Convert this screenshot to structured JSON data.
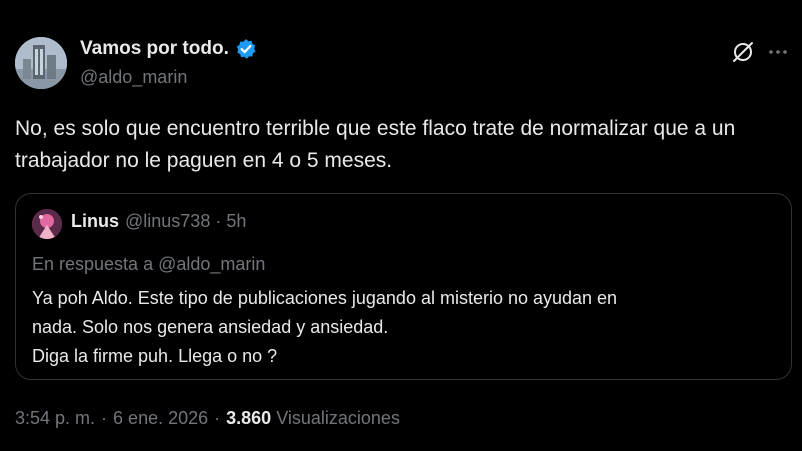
{
  "author": {
    "name": "Vamos por todo.",
    "handle": "@aldo_marin",
    "verified_color": "#1d9bf0"
  },
  "tweet": {
    "text": "No, es solo que encuentro terrible que este flaco trate de normalizar que a un trabajador no le paguen en 4 o 5 meses."
  },
  "icons": {
    "grok": "grok-icon",
    "more": "more-icon"
  },
  "quote": {
    "name": "Linus",
    "handle": "@linus738",
    "separator": "·",
    "time": "5h",
    "reply_to": "En respuesta a @aldo_marin",
    "lines": [
      "Ya poh Aldo. Este tipo de publicaciones jugando al misterio no ayudan en",
      "nada. Solo nos genera ansiedad y ansiedad.",
      "Diga la firme puh. Llega o no ?"
    ]
  },
  "meta": {
    "time": "3:54 p. m.",
    "separator": "·",
    "date": "6 ene. 2026",
    "views_count": "3.860",
    "views_label": "Visualizaciones"
  }
}
